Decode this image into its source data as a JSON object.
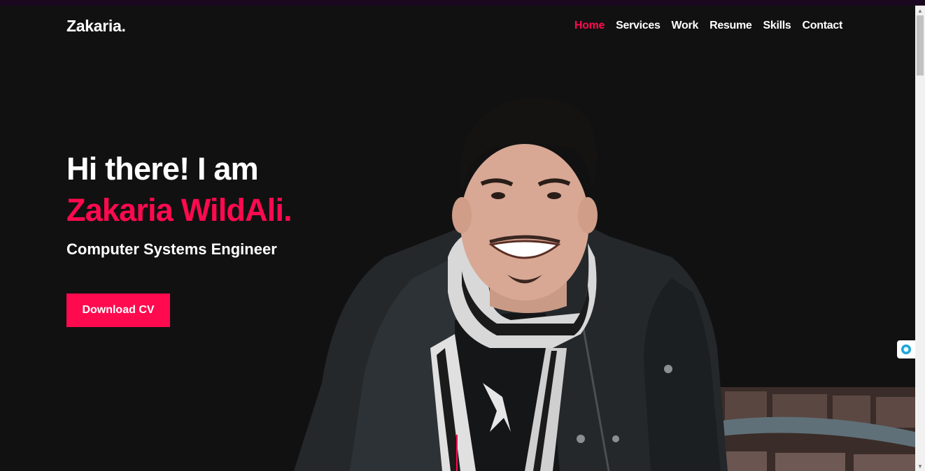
{
  "brand": "Zakaria.",
  "nav": {
    "items": [
      {
        "label": "Home",
        "active": true
      },
      {
        "label": "Services",
        "active": false
      },
      {
        "label": "Work",
        "active": false
      },
      {
        "label": "Resume",
        "active": false
      },
      {
        "label": "Skills",
        "active": false
      },
      {
        "label": "Contact",
        "active": false
      }
    ]
  },
  "hero": {
    "greeting": "Hi there! I am",
    "name": "Zakaria WildAli.",
    "title": "Computer Systems Engineer",
    "cta_label": "Download CV"
  },
  "colors": {
    "accent": "#ff0a4f",
    "background": "#121112",
    "text": "#ffffff"
  },
  "icons": {
    "portrait": "person-portrait-photo",
    "side_widget": "assistant-orb-icon",
    "scroll_up": "scroll-up-arrow-icon",
    "scroll_down": "scroll-down-arrow-icon"
  }
}
